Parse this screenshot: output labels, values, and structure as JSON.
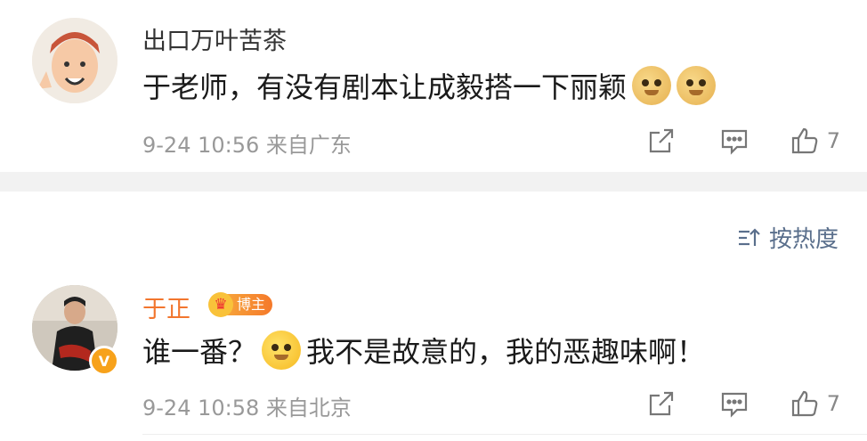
{
  "comments": [
    {
      "username": "出口万叶苦茶",
      "text": "于老师，有没有剧本让成毅搭一下丽颖",
      "emojis": [
        "doge-emoji",
        "doge-emoji"
      ],
      "timestamp": "9-24 10:56",
      "location": "来自广东",
      "likes": "7"
    },
    {
      "username": "于正",
      "badge": "博主",
      "text_before": "谁一番？",
      "text_after": "我不是故意的，我的恶趣味啊！",
      "timestamp": "9-24 10:58",
      "location": "来自北京",
      "likes": "7",
      "verified_mark": "V"
    }
  ],
  "sort": {
    "label": "按热度"
  },
  "colors": {
    "accent_name": "#f2762e",
    "meta": "#999999",
    "sort": "#5a6f8c",
    "divider": "#f2f2f2"
  },
  "icons": [
    "share-icon",
    "comment-icon",
    "like-icon",
    "sort-icon",
    "crown-icon",
    "verified-badge-icon"
  ]
}
